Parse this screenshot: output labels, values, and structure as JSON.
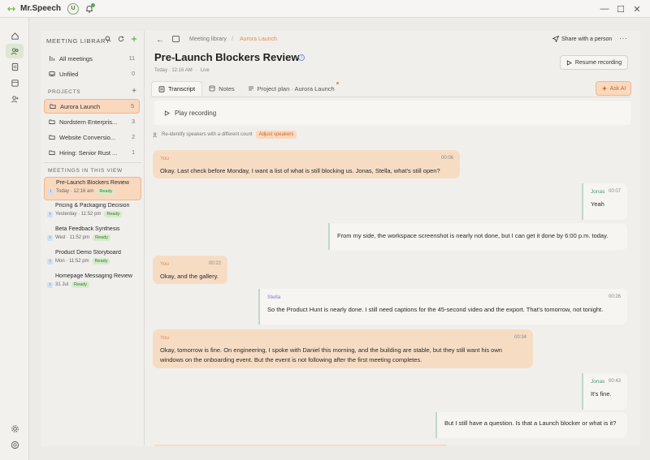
{
  "app": {
    "name": "Mr.Speech",
    "avatar_initial": "U"
  },
  "window": {
    "minimize": "—",
    "maximize": "☐",
    "close": "✕"
  },
  "library": {
    "heading": "MEETING LIBRARY",
    "items": [
      {
        "label": "All meetings",
        "count": "11"
      },
      {
        "label": "Unfiled",
        "count": "0"
      }
    ],
    "projects_label": "PROJECTS",
    "projects": [
      {
        "label": "Aurora Launch",
        "count": "5"
      },
      {
        "label": "Nordstern Enterpris...",
        "count": "3"
      },
      {
        "label": "Website Conversio...",
        "count": "2"
      },
      {
        "label": "Hiring: Senior Rust ...",
        "count": "1"
      }
    ],
    "meetings_label": "MEETINGS IN THIS VIEW",
    "meetings": [
      {
        "title": "Pre-Launch Blockers Review",
        "date": "Today · 12:16 am",
        "status": "Ready"
      },
      {
        "title": "Pricing & Packaging Decision",
        "date": "Yesterday · 11:52 pm",
        "status": "Ready"
      },
      {
        "title": "Beta Feedback Synthesis",
        "date": "Wed · 11:52 pm",
        "status": "Ready"
      },
      {
        "title": "Product Demo Storyboard",
        "date": "Mon · 11:52 pm",
        "status": "Ready"
      },
      {
        "title": "Homepage Messaging Review",
        "date": "31 Jul",
        "status": "Ready"
      }
    ]
  },
  "header": {
    "breadcrumb_root": "Meeting library",
    "breadcrumb_sep": "/",
    "breadcrumb_current": "Aurora Launch",
    "share_label": "Share with a person",
    "more": "···",
    "title": "Pre-Launch Blockers Review",
    "subtitle_date": "Today · 12:16 AM",
    "subtitle_dot": "·",
    "subtitle_status": "Live",
    "resume_label": "Resume recording"
  },
  "tabs": [
    {
      "label": "Transcript"
    },
    {
      "label": "Notes"
    },
    {
      "label": "Project plan · Aurora Launch"
    }
  ],
  "ask_ai": "Ask AI",
  "play_label": "Play recording",
  "reidentify": {
    "text": "Re-identify speakers with a different count",
    "button": "Adjust speakers"
  },
  "messages": [
    {
      "speaker": "You",
      "time": "00:06",
      "text": "Okay. Last check before Monday, I want a list of what is still blocking us. Jonas, Stella, what's still open?"
    },
    {
      "speaker": "Jonas",
      "time": "00:07",
      "text": "Yeah"
    },
    {
      "speaker": "",
      "time": "",
      "text": "From my side, the workspace screenshot is nearly not done, but I can get it done by 6:00 p.m. today."
    },
    {
      "speaker": "You",
      "time": "00:22",
      "text": "Okay, and the gallery."
    },
    {
      "speaker": "Stella",
      "time": "00:26",
      "text": "So the Product Hunt is nearly done. I still need captions for the 45-second video and the export. That's tomorrow, not tonight."
    },
    {
      "speaker": "You",
      "time": "00:34",
      "text": "Okay, tomorrow is fine. On engineering, I spoke with Daniel this morning, and the building are stable, but they still want his own windows on the onboarding event. But the event is not following after the first meeting completes."
    },
    {
      "speaker": "Jonas",
      "time": "00:43",
      "text": "It's fine."
    },
    {
      "speaker": "",
      "time": "",
      "text": "But I still have a question. Is that a Launch blocker or what is it?"
    }
  ]
}
